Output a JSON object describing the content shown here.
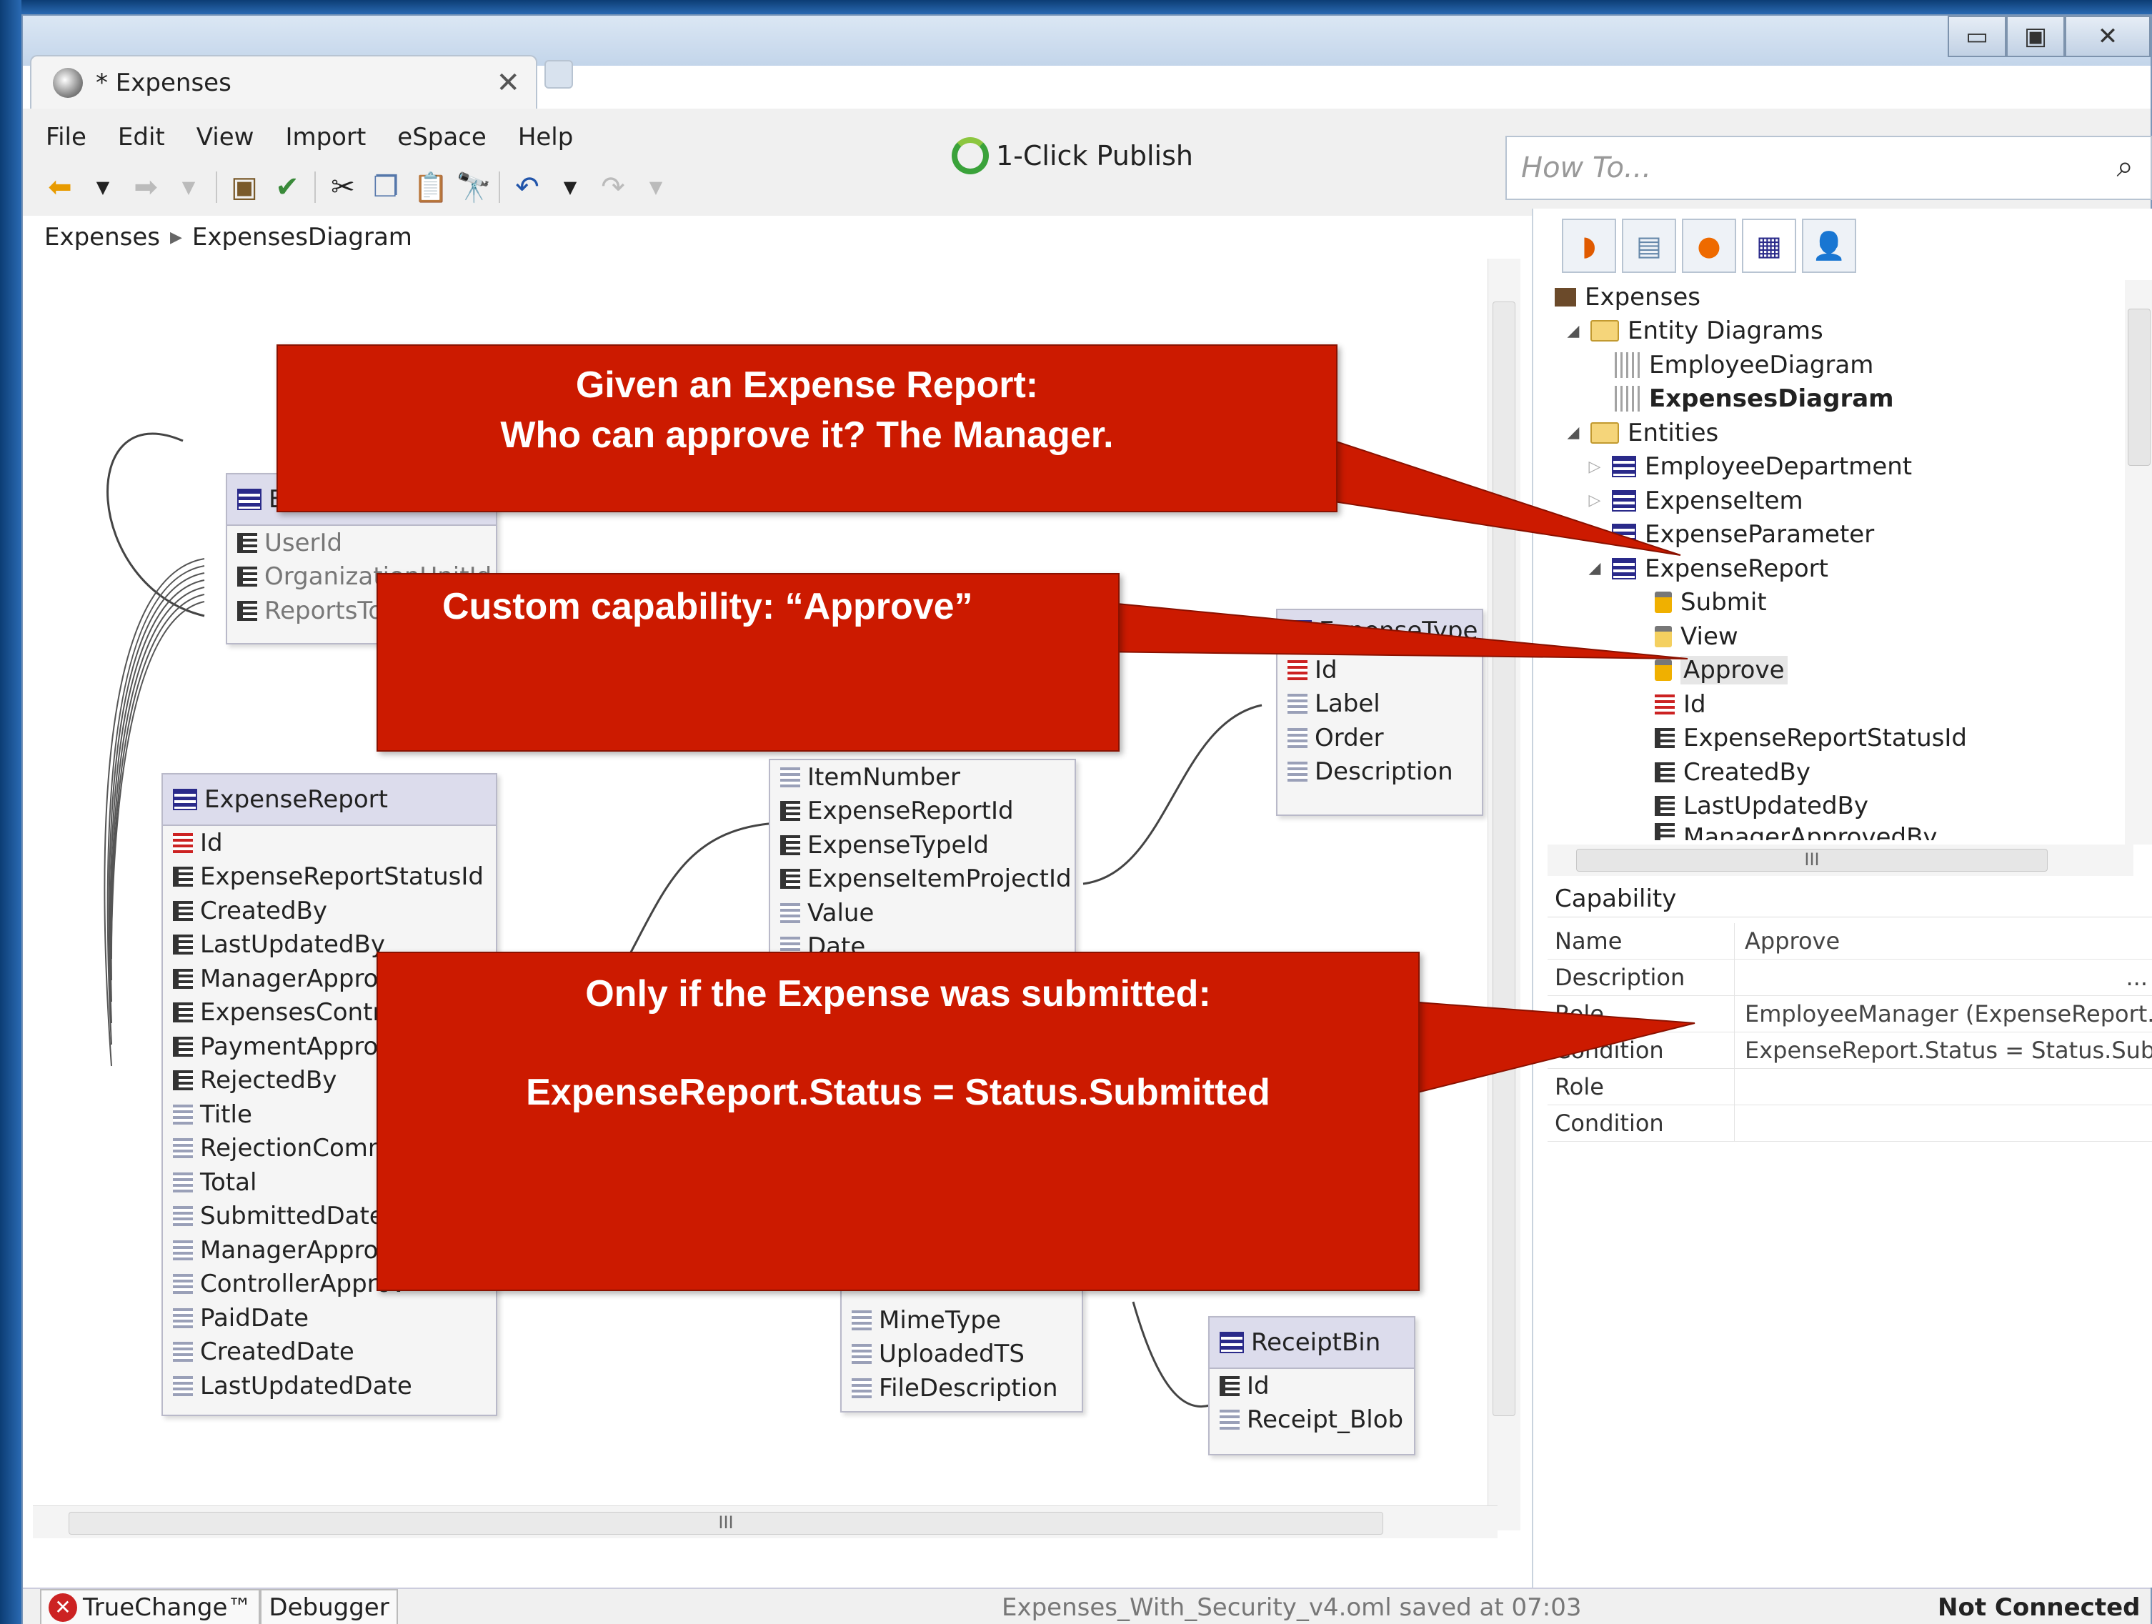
{
  "window": {
    "tab_title": "* Expenses",
    "close_glyph": "✕",
    "winbtns": [
      "▭",
      "▣",
      "✕"
    ]
  },
  "menu": [
    "File",
    "Edit",
    "View",
    "Import",
    "eSpace",
    "Help"
  ],
  "toolbar_icons": [
    "back-icon",
    "dropdown-icon",
    "forward-icon",
    "dropdown-icon",
    "save-icon",
    "check-icon",
    "cut-icon",
    "copy-icon",
    "paste-icon",
    "find-icon",
    "undo-icon",
    "dropdown-icon",
    "redo-icon",
    "dropdown-icon"
  ],
  "publish_label": "1-Click Publish",
  "howto_placeholder": "How To...",
  "breadcrumb": {
    "root": "Expenses",
    "sep": "▶",
    "current": "ExpensesDiagram"
  },
  "entities": {
    "user": {
      "title": "Er",
      "rows": [
        "UserId",
        "OrganizationUnitId",
        "ReportsToI"
      ]
    },
    "expense_type": {
      "title": "ExpenseType",
      "rows": [
        "Id",
        "Label",
        "Order",
        "Description"
      ]
    },
    "expense_report": {
      "title": "ExpenseReport",
      "rows": [
        "Id",
        "ExpenseReportStatusId",
        "CreatedBy",
        "LastUpdatedBy",
        "ManagerApprove",
        "ExpensesControl",
        "PaymentApprove",
        "RejectedBy",
        "Title",
        "RejectionComme",
        "Total",
        "SubmittedDate",
        "ManagerApprove",
        "ControllerApprov",
        "PaidDate",
        "CreatedDate",
        "LastUpdatedDate"
      ]
    },
    "expense_item": {
      "rows": [
        "ItemNumber",
        "ExpenseReportId",
        "ExpenseTypeId",
        "ExpenseItemProjectId",
        "Value",
        "Date"
      ]
    },
    "receipt": {
      "rows": [
        "MimeType",
        "UploadedTS",
        "FileDescription"
      ]
    },
    "receipt_bin": {
      "title": "ReceiptBin",
      "rows": [
        "Id",
        "Receipt_Blob"
      ]
    }
  },
  "callouts": {
    "manager": {
      "line1": "Given an Expense Report:",
      "line2": "Who can approve it? The Manager."
    },
    "approve": {
      "line1": "Custom capability: “Approve”"
    },
    "submitted": {
      "line1": "Only if the Expense was submitted:",
      "line2": "ExpenseReport.Status = Status.Submitted"
    }
  },
  "tree": {
    "root": "Expenses",
    "diagrams_folder": "Entity Diagrams",
    "diagrams": [
      "EmployeeDiagram",
      "ExpensesDiagram"
    ],
    "entities_folder": "Entities",
    "entities": [
      "EmployeeDepartment",
      "ExpenseItem",
      "ExpenseParameter",
      "ExpenseReport"
    ],
    "capabilities": [
      "Submit",
      "View",
      "Approve"
    ],
    "attributes": [
      "Id",
      "ExpenseReportStatusId",
      "CreatedBy",
      "LastUpdatedBy",
      "ManagerApprovedBy"
    ]
  },
  "properties": {
    "header": "Capability",
    "rows": [
      {
        "key": "Name",
        "value": "Approve"
      },
      {
        "key": "Description",
        "value": "..."
      },
      {
        "key": "Role",
        "value": "EmployeeManager (ExpenseReport.Cr"
      },
      {
        "key": "Condition",
        "value": "ExpenseReport.Status = Status.Submit"
      },
      {
        "key": "Role",
        "value": ""
      },
      {
        "key": "Condition",
        "value": ""
      }
    ]
  },
  "statusbar": {
    "truechange": "TrueChange™",
    "debugger": "Debugger",
    "file": "Expenses_With_Security_v4.oml saved at 07:03",
    "connection": "Not Connected"
  },
  "colors": {
    "callout": "#cc1a00",
    "accent": "#3aa23a"
  }
}
